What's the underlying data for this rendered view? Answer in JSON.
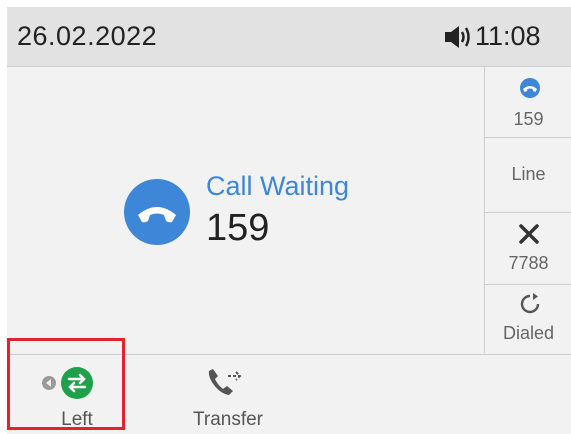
{
  "status_bar": {
    "date": "26.02.2022",
    "time": "11:08",
    "speaker_icon": "speaker-volume-icon"
  },
  "call": {
    "status": "Call Waiting",
    "number": "159",
    "icon": "handset-hangup-icon",
    "accent_color": "#3d86d8"
  },
  "side_keys": [
    {
      "label": "159",
      "icon": "contact-icon"
    },
    {
      "label": "Line",
      "icon": ""
    },
    {
      "label": "7788",
      "icon": "missed-call-x-icon"
    },
    {
      "label": "Dialed",
      "icon": "redial-icon"
    }
  ],
  "soft_keys": [
    {
      "label": "Left",
      "icon": "swap-arrows-icon",
      "icon_color": "#1fa04a"
    },
    {
      "label": "Transfer",
      "icon": "transfer-call-icon"
    }
  ],
  "highlight_color": "#e5222b"
}
